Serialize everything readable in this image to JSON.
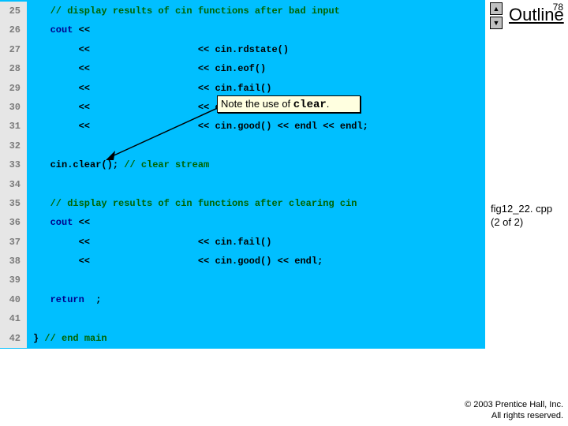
{
  "slide_number": "78",
  "outline_label": "Outline",
  "caption_file": "fig12_22. cpp",
  "caption_part": "(2 of 2)",
  "copyright_line1": "© 2003 Prentice Hall, Inc.",
  "copyright_line2": "All rights reserved.",
  "callout_prefix": "Note the use of ",
  "callout_kw": "clear",
  "callout_suffix": ".",
  "scroll_up_glyph": "▲",
  "scroll_down_glyph": "▼",
  "lines": {
    "25": {
      "n": "25",
      "comment": "   // display results of cin functions after bad input"
    },
    "26": {
      "n": "26",
      "kw": "   cout",
      "rest": " << "
    },
    "27": {
      "n": "27",
      "indent": "        << ",
      "rest2": "                  << cin.rdstate()"
    },
    "28": {
      "n": "28",
      "indent": "        << ",
      "rest2": "                  << cin.eof()"
    },
    "29": {
      "n": "29",
      "indent": "        << ",
      "rest2": "                  << cin.fail()"
    },
    "30": {
      "n": "30",
      "indent": "        << ",
      "rest2": "                  << cin.bad()"
    },
    "31": {
      "n": "31",
      "indent": "        << ",
      "rest2": "                  << cin.good() << endl << endl;"
    },
    "32": {
      "n": "32"
    },
    "33": {
      "n": "33",
      "code": "   cin.clear(); ",
      "comment2": "// clear stream"
    },
    "34": {
      "n": "34"
    },
    "35": {
      "n": "35",
      "comment": "   // display results of cin functions after clearing cin"
    },
    "36": {
      "n": "36",
      "kw": "   cout",
      "rest": " << "
    },
    "37": {
      "n": "37",
      "indent": "        << ",
      "rest2": "                  << cin.fail()"
    },
    "38": {
      "n": "38",
      "indent": "        << ",
      "rest2": "                  << cin.good() << endl;"
    },
    "39": {
      "n": "39"
    },
    "40": {
      "n": "40",
      "kw": "   return",
      "rest": "  ;"
    },
    "41": {
      "n": "41"
    },
    "42": {
      "n": "42",
      "code": "} ",
      "comment2": "// end main"
    }
  }
}
